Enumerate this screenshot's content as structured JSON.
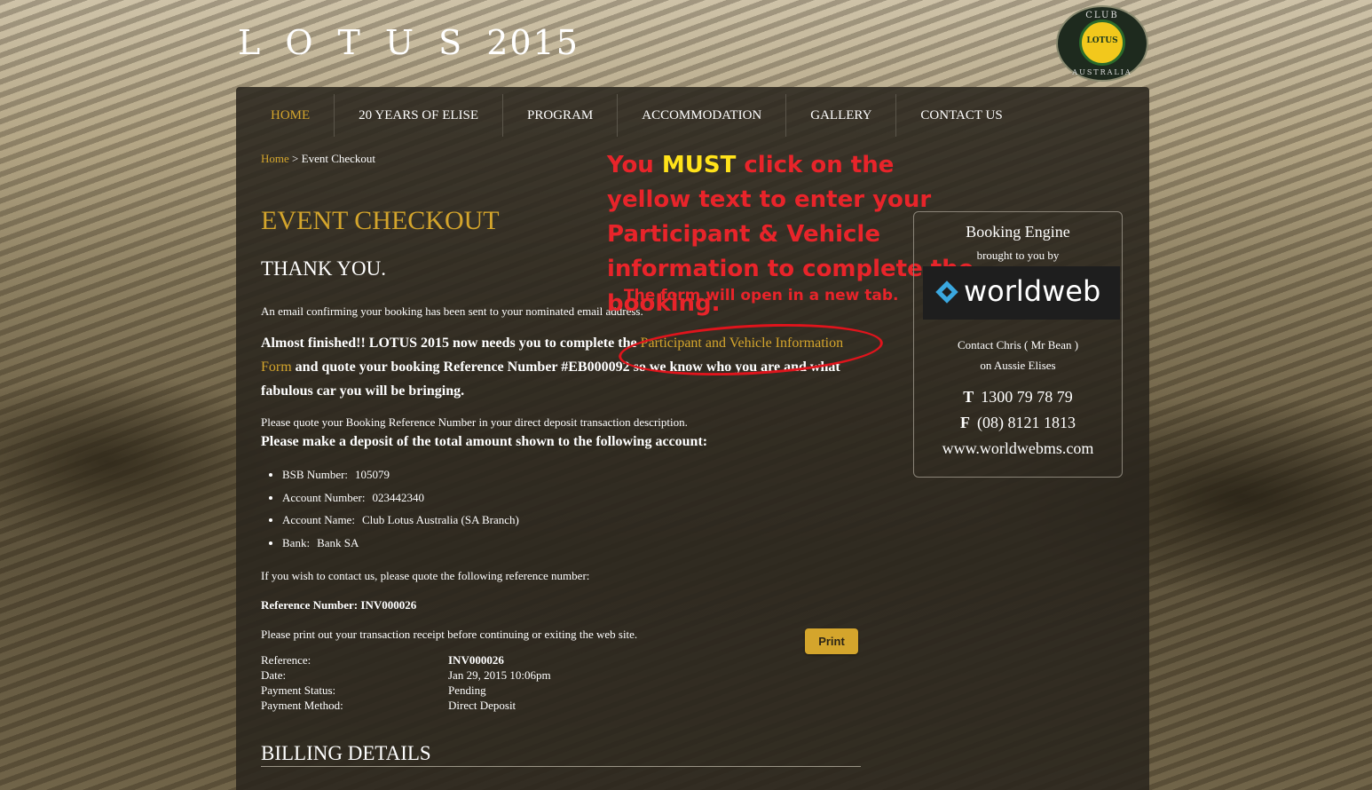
{
  "site": {
    "title_main": "L O T U S",
    "title_year": "2015",
    "logo": {
      "top": "CLUB",
      "center": "LOTUS",
      "bottom": "AUSTRALIA"
    }
  },
  "nav": {
    "items": [
      {
        "label": "HOME",
        "active": true
      },
      {
        "label": "20 YEARS OF ELISE"
      },
      {
        "label": "PROGRAM"
      },
      {
        "label": "ACCOMMODATION"
      },
      {
        "label": "GALLERY"
      },
      {
        "label": "CONTACT US"
      }
    ]
  },
  "breadcrumb": {
    "home": "Home",
    "separator": ">",
    "current": "Event Checkout"
  },
  "page": {
    "title": "EVENT CHECKOUT",
    "thanks": "THANK YOU.",
    "email_note": "An email confirming your booking has been sent to your nominated email address.",
    "almost_pre": "Almost finished!! LOTUS 2015 now needs you to complete the ",
    "almost_link": "Participant and Vehicle Information Form",
    "almost_post": " and quote your booking Reference Number #EB000092 so we know who you are and what fabulous car you will be bringing.",
    "quote_note": "Please quote your Booking Reference Number in your direct deposit transaction description.",
    "deposit_heading": "Please make a deposit of the total amount shown to the following account:",
    "bank": [
      {
        "key": "BSB Number:",
        "value": "105079"
      },
      {
        "key": "Account Number:",
        "value": "023442340"
      },
      {
        "key": "Account Name:",
        "value": "Club Lotus Australia (SA Branch)"
      },
      {
        "key": "Bank:",
        "value": "Bank SA"
      }
    ],
    "contact_note": "If you wish to contact us, please quote the following reference number:",
    "reference_line": "Reference Number: INV000026",
    "print_note": "Please print out your transaction receipt before continuing or exiting the web site.",
    "print_button": "Print",
    "transaction": [
      {
        "key": "Reference:",
        "value": "INV000026",
        "bold": true
      },
      {
        "key": "Date:",
        "value": "Jan 29, 2015 10:06pm"
      },
      {
        "key": "Payment Status:",
        "value": "Pending"
      },
      {
        "key": "Payment Method:",
        "value": "Direct Deposit"
      }
    ],
    "billing_heading": "BILLING DETAILS"
  },
  "annotation": {
    "line_pre": "You ",
    "must": "MUST",
    "line_post": " click on the yellow text to enter your Participant & Vehicle information to complete the booking.",
    "sub": "The form will open in a new tab.",
    "colors": {
      "text": "#e8242a",
      "must": "#ffe21a",
      "ellipse": "#e0141c"
    }
  },
  "sidebar": {
    "title": "Booking Engine",
    "brought_by": "brought to you by",
    "logo_text": "worldweb",
    "contact1": "Contact Chris ( Mr Bean )",
    "contact2": "on Aussie Elises",
    "phone_label": "T",
    "phone": "1300 79 78 79",
    "fax_label": "F",
    "fax": "(08) 8121 1813",
    "website": "www.worldwebms.com"
  },
  "colors": {
    "accent": "#d4a52c",
    "panel": "#2a261e",
    "text": "#ffffff"
  }
}
